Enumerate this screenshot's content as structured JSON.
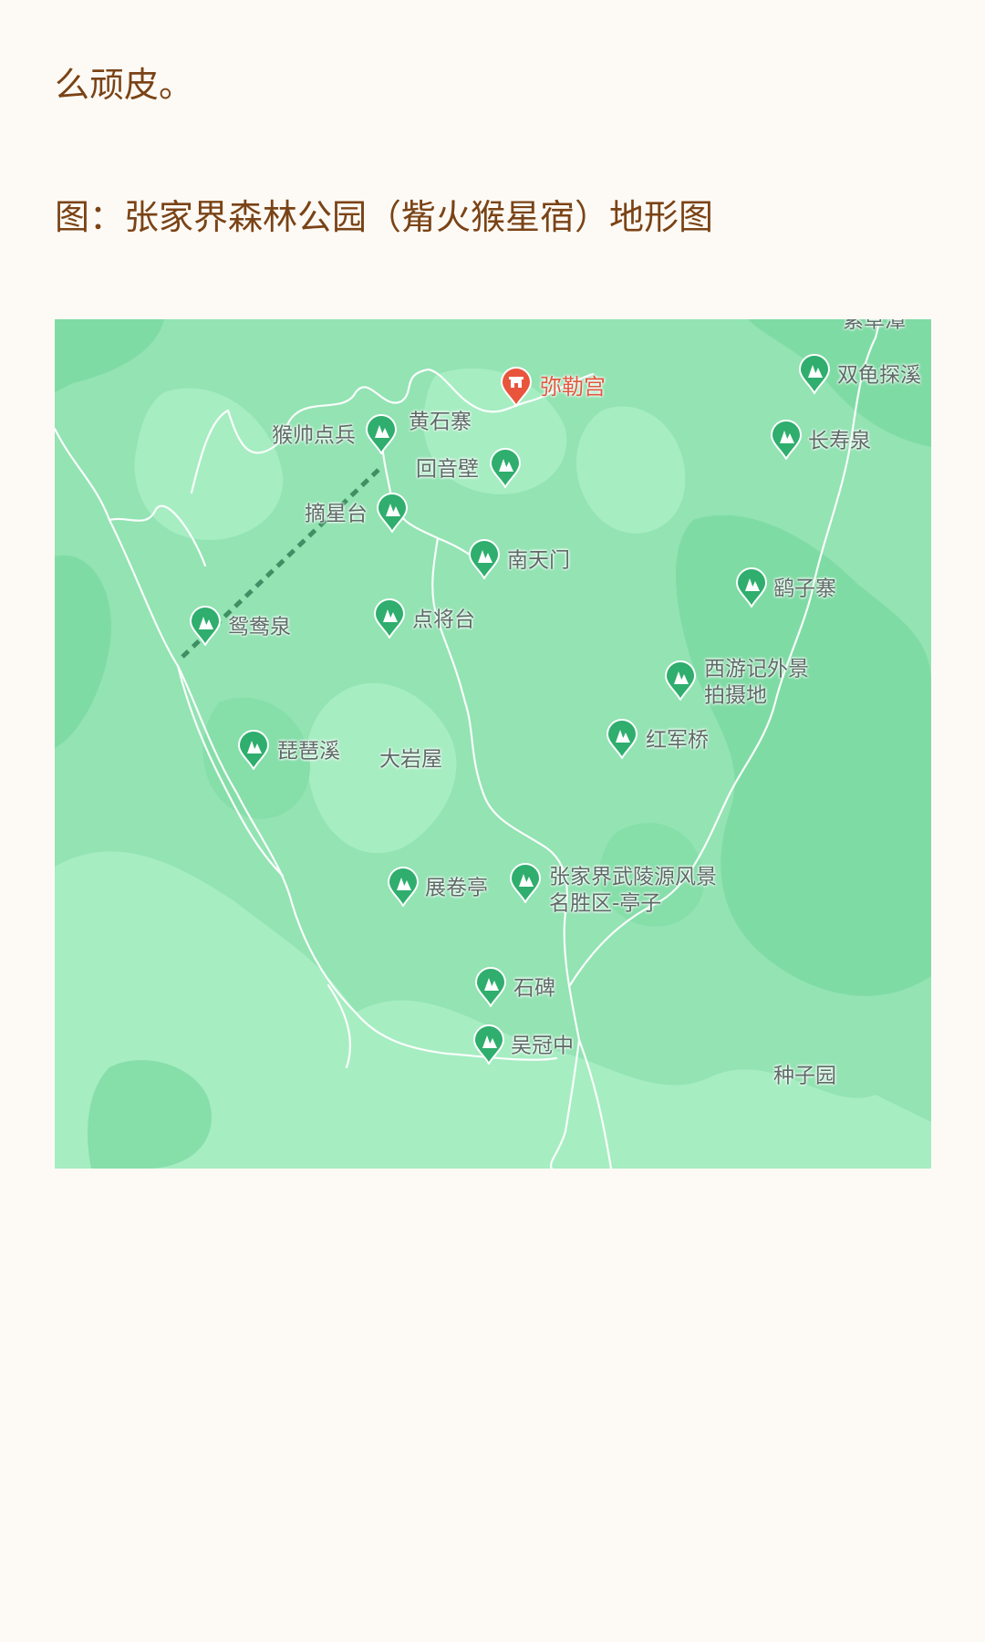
{
  "article": {
    "intro_tail": "么顽皮。",
    "figure_caption": "图：张家界森林公园（觜火猴星宿）地形图"
  },
  "map": {
    "colors": {
      "terrain_base": "#93e3b3",
      "terrain_light": "#a9efc4",
      "terrain_dark": "#7bd9a1",
      "road": "#ffffff",
      "poi_marker": "#2fae6e",
      "highlight_marker": "#e8553c"
    },
    "highlight_poi": {
      "name": "弥勒宫",
      "icon": "temple-icon"
    },
    "pois": [
      {
        "name": "猴帅点兵",
        "icon": "scenic-spot-icon"
      },
      {
        "name": "回音壁",
        "icon": "scenic-spot-icon"
      },
      {
        "name": "摘星台",
        "icon": "scenic-spot-icon"
      },
      {
        "name": "南天门",
        "icon": "scenic-spot-icon"
      },
      {
        "name": "鸳鸯泉",
        "icon": "scenic-spot-icon"
      },
      {
        "name": "点将台",
        "icon": "scenic-spot-icon"
      },
      {
        "name": "琵琶溪",
        "icon": "scenic-spot-icon"
      },
      {
        "name": "展卷亭",
        "icon": "scenic-spot-icon"
      },
      {
        "name": "张家界武陵源风景",
        "line2": "名胜区-亭子",
        "icon": "scenic-spot-icon"
      },
      {
        "name": "石碑",
        "icon": "scenic-spot-icon"
      },
      {
        "name": "吴冠中",
        "icon": "scenic-spot-icon"
      },
      {
        "name": "双龟探溪",
        "icon": "scenic-spot-icon"
      },
      {
        "name": "长寿泉",
        "icon": "scenic-spot-icon"
      },
      {
        "name": "鹞子寨",
        "icon": "scenic-spot-icon"
      },
      {
        "name": "西游记外景",
        "line2": "拍摄地",
        "icon": "scenic-spot-icon"
      },
      {
        "name": "红军桥",
        "icon": "scenic-spot-icon"
      }
    ],
    "area_labels": [
      "黄石寨",
      "大岩屋",
      "种子园"
    ],
    "cut_off_label": "紫草潭"
  }
}
